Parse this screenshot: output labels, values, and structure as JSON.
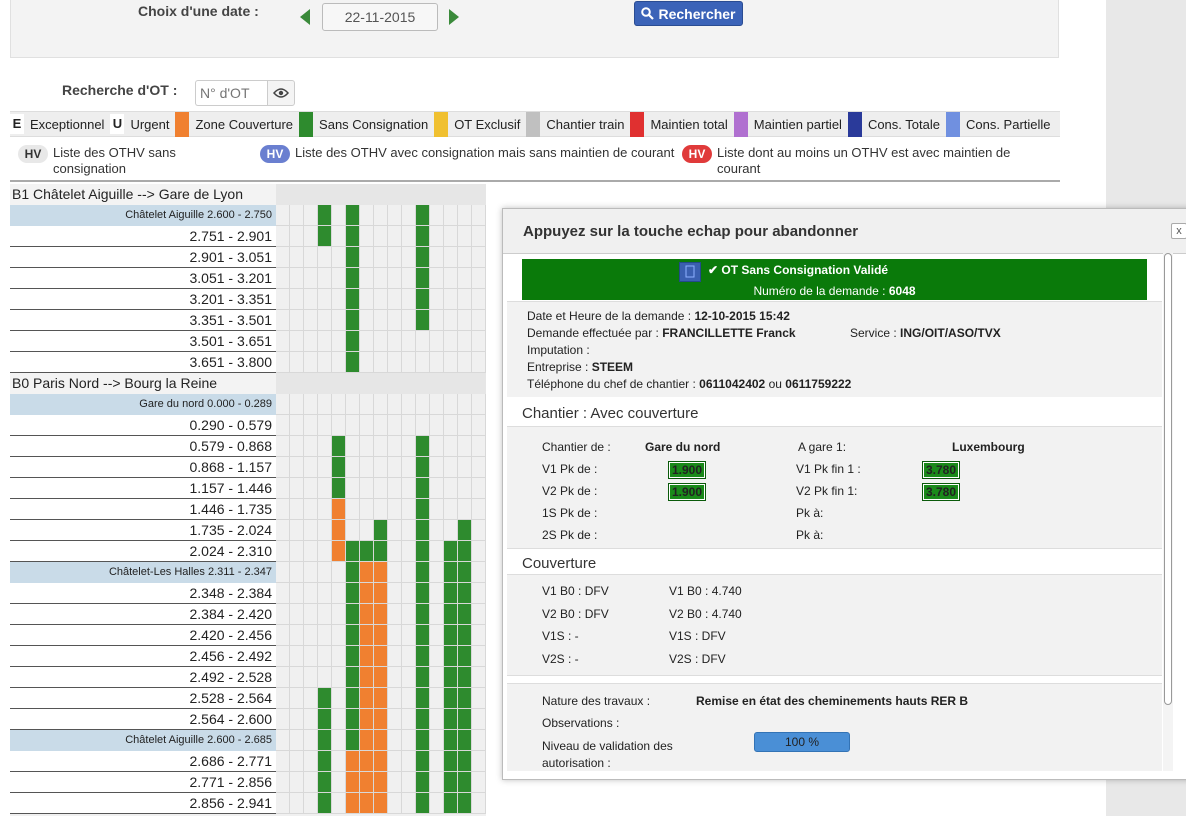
{
  "search": {
    "date_label": "Choix d'une date :",
    "date_value": "22-11-2015",
    "search_button": "Rechercher",
    "ot_label": "Recherche d'OT :",
    "ot_placeholder": "N° d'OT"
  },
  "legend": [
    {
      "key": "E",
      "label": "Exceptionnel",
      "type": "letter"
    },
    {
      "key": "U",
      "label": "Urgent",
      "type": "letter"
    },
    {
      "color": "#f08030",
      "label": "Zone Couverture",
      "type": "swatch"
    },
    {
      "color": "#2e8b2e",
      "label": "Sans Consignation",
      "type": "swatch"
    },
    {
      "color": "#f0c030",
      "label": "OT Exclusif",
      "type": "swatch"
    },
    {
      "color": "#c0c0c0",
      "label": "Chantier train",
      "type": "swatch"
    },
    {
      "color": "#e03030",
      "label": "Maintien total",
      "type": "swatch"
    },
    {
      "color": "#b070d0",
      "label": "Maintien partiel",
      "type": "swatch"
    },
    {
      "color": "#2a3a9a",
      "label": "Cons. Totale",
      "type": "swatch"
    },
    {
      "color": "#7090e0",
      "label": "Cons. Partielle",
      "type": "swatch"
    }
  ],
  "hv": [
    {
      "badge": "HV",
      "text": "Liste des OTHV sans consignation",
      "bg": "#e8e8e8",
      "fg": "#333"
    },
    {
      "badge": "HV",
      "text": "Liste des OTHV avec consignation mais sans maintien de courant",
      "bg": "#6a7fd0",
      "fg": "#fff"
    },
    {
      "badge": "HV",
      "text": "Liste dont au moins un OTHV est avec maintien de courant",
      "bg": "#e03a3a",
      "fg": "#fff"
    }
  ],
  "grid_rows": [
    {
      "kind": "section",
      "label": "B1 Châtelet Aiguille --> Gare de Lyon",
      "cells": []
    },
    {
      "kind": "sub",
      "label": "Châtelet Aiguille 2.600 - 2.750",
      "cells": [
        [
          3,
          "g"
        ],
        [
          5,
          "g"
        ],
        [
          10,
          "g"
        ]
      ]
    },
    {
      "kind": "row",
      "label": "2.751 - 2.901",
      "cells": [
        [
          3,
          "g"
        ],
        [
          5,
          "g"
        ],
        [
          10,
          "g"
        ]
      ]
    },
    {
      "kind": "row",
      "label": "2.901 - 3.051",
      "cells": [
        [
          5,
          "g"
        ],
        [
          10,
          "g"
        ]
      ]
    },
    {
      "kind": "row",
      "label": "3.051 - 3.201",
      "cells": [
        [
          5,
          "g"
        ],
        [
          10,
          "g"
        ]
      ]
    },
    {
      "kind": "row",
      "label": "3.201 - 3.351",
      "cells": [
        [
          5,
          "g"
        ],
        [
          10,
          "g"
        ]
      ]
    },
    {
      "kind": "row",
      "label": "3.351 - 3.501",
      "cells": [
        [
          5,
          "g"
        ],
        [
          10,
          "g"
        ]
      ]
    },
    {
      "kind": "row",
      "label": "3.501 - 3.651",
      "cells": [
        [
          5,
          "g"
        ]
      ]
    },
    {
      "kind": "row",
      "label": "3.651 - 3.800",
      "cells": [
        [
          5,
          "g"
        ]
      ]
    },
    {
      "kind": "section",
      "label": "B0 Paris Nord --> Bourg la Reine",
      "cells": []
    },
    {
      "kind": "sub",
      "label": "Gare du nord 0.000 - 0.289",
      "cells": []
    },
    {
      "kind": "row",
      "label": "0.290 - 0.579",
      "cells": []
    },
    {
      "kind": "row",
      "label": "0.579 - 0.868",
      "cells": [
        [
          4,
          "g"
        ],
        [
          10,
          "g"
        ]
      ]
    },
    {
      "kind": "row",
      "label": "0.868 - 1.157",
      "cells": [
        [
          4,
          "g"
        ],
        [
          10,
          "g"
        ]
      ]
    },
    {
      "kind": "row",
      "label": "1.157 - 1.446",
      "cells": [
        [
          4,
          "g"
        ],
        [
          10,
          "g"
        ]
      ]
    },
    {
      "kind": "row",
      "label": "1.446 - 1.735",
      "cells": [
        [
          4,
          "o"
        ],
        [
          10,
          "g"
        ]
      ]
    },
    {
      "kind": "row",
      "label": "1.735 - 2.024",
      "cells": [
        [
          4,
          "o"
        ],
        [
          7,
          "g"
        ],
        [
          10,
          "g"
        ],
        [
          13,
          "g"
        ]
      ]
    },
    {
      "kind": "row",
      "label": "2.024 - 2.310",
      "cells": [
        [
          4,
          "o"
        ],
        [
          5,
          "g"
        ],
        [
          6,
          "g"
        ],
        [
          7,
          "g"
        ],
        [
          10,
          "g"
        ],
        [
          12,
          "g"
        ],
        [
          13,
          "g"
        ]
      ]
    },
    {
      "kind": "sub",
      "label": "Châtelet-Les Halles 2.311 - 2.347",
      "cells": [
        [
          5,
          "g"
        ],
        [
          6,
          "o"
        ],
        [
          7,
          "o"
        ],
        [
          10,
          "g"
        ],
        [
          12,
          "g"
        ],
        [
          13,
          "g"
        ]
      ]
    },
    {
      "kind": "row",
      "label": "2.348 - 2.384",
      "cells": [
        [
          5,
          "g"
        ],
        [
          6,
          "o"
        ],
        [
          7,
          "o"
        ],
        [
          10,
          "g"
        ],
        [
          12,
          "g"
        ],
        [
          13,
          "g"
        ]
      ]
    },
    {
      "kind": "row",
      "label": "2.384 - 2.420",
      "cells": [
        [
          5,
          "g"
        ],
        [
          6,
          "o"
        ],
        [
          7,
          "o"
        ],
        [
          10,
          "g"
        ],
        [
          12,
          "g"
        ],
        [
          13,
          "g"
        ]
      ]
    },
    {
      "kind": "row",
      "label": "2.420 - 2.456",
      "cells": [
        [
          5,
          "g"
        ],
        [
          6,
          "o"
        ],
        [
          7,
          "o"
        ],
        [
          10,
          "g"
        ],
        [
          12,
          "g"
        ],
        [
          13,
          "g"
        ]
      ]
    },
    {
      "kind": "row",
      "label": "2.456 - 2.492",
      "cells": [
        [
          5,
          "g"
        ],
        [
          6,
          "o"
        ],
        [
          7,
          "o"
        ],
        [
          10,
          "g"
        ],
        [
          12,
          "g"
        ],
        [
          13,
          "g"
        ]
      ]
    },
    {
      "kind": "row",
      "label": "2.492 - 2.528",
      "cells": [
        [
          5,
          "g"
        ],
        [
          6,
          "o"
        ],
        [
          7,
          "o"
        ],
        [
          10,
          "g"
        ],
        [
          12,
          "g"
        ],
        [
          13,
          "g"
        ]
      ]
    },
    {
      "kind": "row",
      "label": "2.528 - 2.564",
      "cells": [
        [
          3,
          "g"
        ],
        [
          5,
          "g"
        ],
        [
          6,
          "o"
        ],
        [
          7,
          "o"
        ],
        [
          10,
          "g"
        ],
        [
          12,
          "g"
        ],
        [
          13,
          "g"
        ]
      ]
    },
    {
      "kind": "row",
      "label": "2.564 - 2.600",
      "cells": [
        [
          3,
          "g"
        ],
        [
          5,
          "g"
        ],
        [
          6,
          "o"
        ],
        [
          7,
          "o"
        ],
        [
          10,
          "g"
        ],
        [
          12,
          "g"
        ],
        [
          13,
          "g"
        ]
      ]
    },
    {
      "kind": "sub",
      "label": "Châtelet Aiguille 2.600 - 2.685",
      "cells": [
        [
          3,
          "g"
        ],
        [
          5,
          "g"
        ],
        [
          6,
          "o"
        ],
        [
          7,
          "o"
        ],
        [
          10,
          "g"
        ],
        [
          12,
          "g"
        ],
        [
          13,
          "g"
        ]
      ]
    },
    {
      "kind": "row",
      "label": "2.686 - 2.771",
      "cells": [
        [
          3,
          "g"
        ],
        [
          5,
          "o"
        ],
        [
          6,
          "o"
        ],
        [
          7,
          "o"
        ],
        [
          10,
          "g"
        ],
        [
          12,
          "g"
        ],
        [
          13,
          "g"
        ]
      ]
    },
    {
      "kind": "row",
      "label": "2.771 - 2.856",
      "cells": [
        [
          3,
          "g"
        ],
        [
          5,
          "o"
        ],
        [
          6,
          "o"
        ],
        [
          7,
          "o"
        ],
        [
          10,
          "g"
        ],
        [
          12,
          "g"
        ],
        [
          13,
          "g"
        ]
      ]
    },
    {
      "kind": "row",
      "label": "2.856 - 2.941",
      "cells": [
        [
          3,
          "g"
        ],
        [
          5,
          "o"
        ],
        [
          6,
          "o"
        ],
        [
          7,
          "o"
        ],
        [
          10,
          "g"
        ],
        [
          12,
          "g"
        ],
        [
          13,
          "g"
        ]
      ]
    }
  ],
  "modal": {
    "title": "Appuyez sur la touche echap pour abandonner",
    "close": "x",
    "banner_status": "OT Sans Consignation Validé",
    "banner_num_label": "Numéro de la demande :",
    "banner_num": "6048",
    "date_label": "Date et Heure de la demande :",
    "date_value": "12-10-2015 15:42",
    "by_label": "Demande effectuée par :",
    "by_value": "FRANCILLETTE Franck",
    "service_label": "Service :",
    "service_value": "ING/OIT/ASO/TVX",
    "imputation_label": "Imputation :",
    "entreprise_label": "Entreprise :",
    "entreprise_value": "STEEM",
    "phone_label": "Téléphone du chef de chantier :",
    "phone1": "0611042402",
    "phone_or": "ou",
    "phone2": "0611759222",
    "chantier_head": "Chantier : Avec couverture",
    "chantier_de_label": "Chantier de :",
    "chantier_de": "Gare du nord",
    "agare_label": "A gare 1:",
    "agare": "Luxembourg",
    "v1pk_label": "V1 Pk de :",
    "v1pk": "1.900",
    "v1pkfin_label": "V1 Pk fin 1 :",
    "v1pkfin": "3.780",
    "v2pk_label": "V2 Pk de :",
    "v2pk": "1.900",
    "v2pkfin_label": "V2 Pk fin 1:",
    "v2pkfin": "3.780",
    "s1_label": "1S Pk de :",
    "s1_a": "Pk à:",
    "s2_label": "2S Pk de :",
    "s2_a": "Pk à:",
    "couv_head": "Couverture",
    "couv": [
      [
        "V1 B0 : DFV",
        "V1 B0 : 4.740"
      ],
      [
        "V2 B0 : DFV",
        "V2 B0 : 4.740"
      ],
      [
        "V1S : -",
        "V1S : DFV"
      ],
      [
        "V2S : -",
        "V2S : DFV"
      ]
    ],
    "nature_label": "Nature des travaux :",
    "nature_value": "Remise en état des cheminements hauts RER B",
    "obs_label": "Observations :",
    "niveau_label": "Niveau de validation des autorisation :",
    "progress_value": 100,
    "progress_text": "100 %"
  },
  "colors": {
    "g": "#2e8b2e",
    "o": "#f08030",
    "accent": "#3b63b8",
    "banner": "#0a7a0a"
  }
}
